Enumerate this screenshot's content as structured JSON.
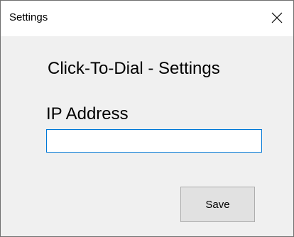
{
  "window": {
    "title": "Settings",
    "close_icon": "close-icon"
  },
  "form": {
    "heading": "Click-To-Dial - Settings",
    "ip_label": "IP Address",
    "ip_value": "",
    "ip_placeholder": ""
  },
  "actions": {
    "save_label": "Save"
  },
  "colors": {
    "focus_border": "#0078d7",
    "button_face": "#e1e1e1",
    "client_area": "#f0f0f0"
  }
}
